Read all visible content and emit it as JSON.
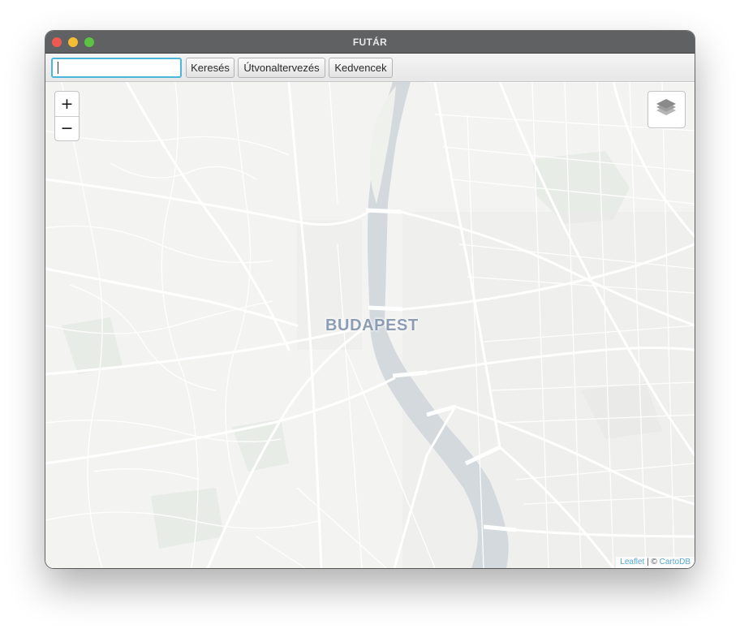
{
  "window": {
    "title": "FUTÁR"
  },
  "toolbar": {
    "search": {
      "value": "",
      "placeholder": ""
    },
    "search_label": "Keresés",
    "route_label": "Útvonaltervezés",
    "favorites_label": "Kedvencek"
  },
  "map": {
    "city_label": "BUDAPEST",
    "zoom_in_label": "+",
    "zoom_out_label": "−",
    "layers_icon": "layers-icon",
    "attribution": {
      "leaflet": "Leaflet",
      "separator": " | © ",
      "provider": "CartoDB"
    },
    "colors": {
      "land": "#f3f3f2",
      "water": "#d3d9dd",
      "roads": "#ffffff",
      "label": "#8c9cb3",
      "park": "#e7ebe5"
    }
  }
}
